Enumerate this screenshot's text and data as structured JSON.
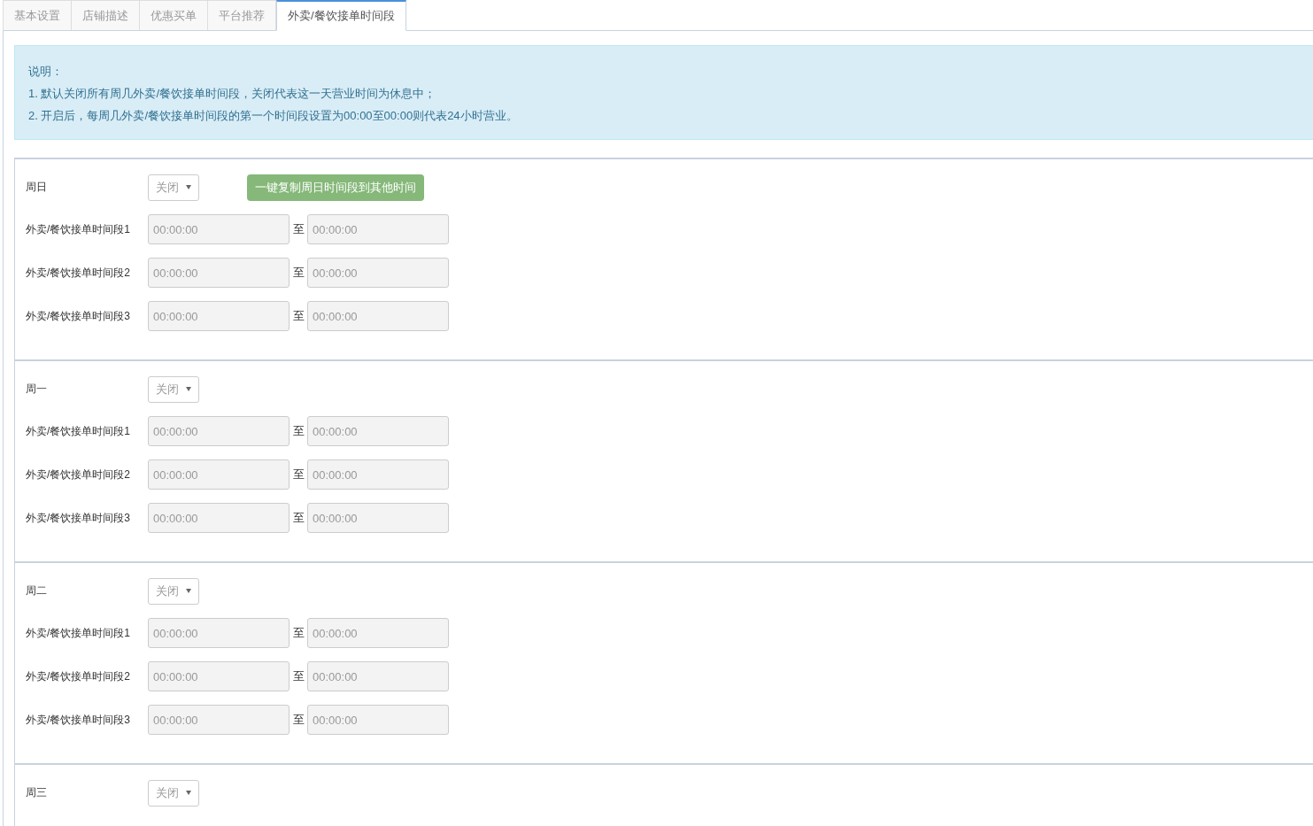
{
  "tabs": [
    {
      "label": "基本设置",
      "selected": false
    },
    {
      "label": "店铺描述",
      "selected": false
    },
    {
      "label": "优惠买单",
      "selected": false
    },
    {
      "label": "平台推荐",
      "selected": false
    },
    {
      "label": "外卖/餐饮接单时间段",
      "selected": true
    }
  ],
  "notice": {
    "title": "说明：",
    "lines": [
      "1. 默认关闭所有周几外卖/餐饮接单时间段，关闭代表这一天营业时间为休息中；",
      "2. 开启后，每周几外卖/餐饮接单时间段的第一个时间段设置为00:00至00:00则代表24小时营业。"
    ]
  },
  "days": [
    {
      "name": "周日",
      "status": "关闭",
      "copy_button": "一键复制周日时间段到其他时间",
      "slots": [
        {
          "label": "外卖/餐饮接单时间段1",
          "from": "00:00:00",
          "separator": "至",
          "to": "00:00:00"
        },
        {
          "label": "外卖/餐饮接单时间段2",
          "from": "00:00:00",
          "separator": "至",
          "to": "00:00:00"
        },
        {
          "label": "外卖/餐饮接单时间段3",
          "from": "00:00:00",
          "separator": "至",
          "to": "00:00:00"
        }
      ]
    },
    {
      "name": "周一",
      "status": "关闭",
      "slots": [
        {
          "label": "外卖/餐饮接单时间段1",
          "from": "00:00:00",
          "separator": "至",
          "to": "00:00:00"
        },
        {
          "label": "外卖/餐饮接单时间段2",
          "from": "00:00:00",
          "separator": "至",
          "to": "00:00:00"
        },
        {
          "label": "外卖/餐饮接单时间段3",
          "from": "00:00:00",
          "separator": "至",
          "to": "00:00:00"
        }
      ]
    },
    {
      "name": "周二",
      "status": "关闭",
      "slots": [
        {
          "label": "外卖/餐饮接单时间段1",
          "from": "00:00:00",
          "separator": "至",
          "to": "00:00:00"
        },
        {
          "label": "外卖/餐饮接单时间段2",
          "from": "00:00:00",
          "separator": "至",
          "to": "00:00:00"
        },
        {
          "label": "外卖/餐饮接单时间段3",
          "from": "00:00:00",
          "separator": "至",
          "to": "00:00:00"
        }
      ]
    },
    {
      "name": "周三",
      "status": "关闭"
    }
  ]
}
